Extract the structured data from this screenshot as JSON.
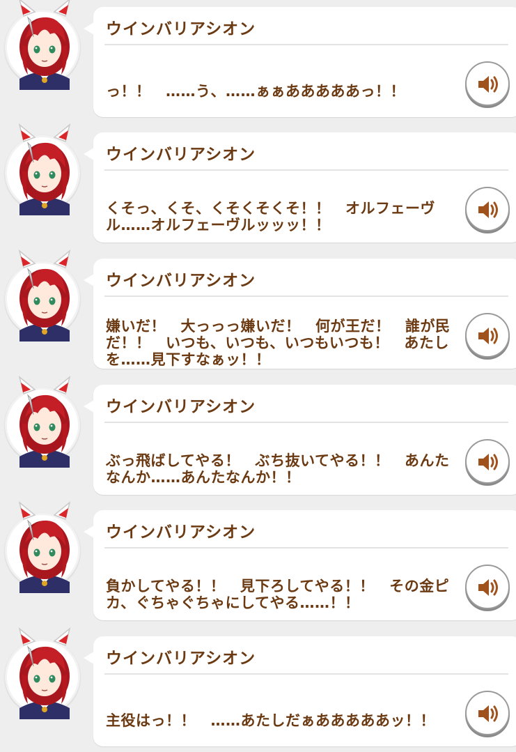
{
  "log": {
    "entries": [
      {
        "speaker": "ウインバリアシオン",
        "text": "っ！！　……う、……ぁぁあああああっ！！",
        "voice_icon": "speaker-icon"
      },
      {
        "speaker": "ウインバリアシオン",
        "text": "くそっ、くそ、くそくそくそ！！　オルフェーヴル……オルフェーヴルッッッ！！",
        "voice_icon": "speaker-icon"
      },
      {
        "speaker": "ウインバリアシオン",
        "text": "嫌いだ！　大っっっ嫌いだ！　何が王だ！　誰が民だ！！　いつも、いつも、いつもいつも！　あたしを……見下すなぁッ！！",
        "voice_icon": "speaker-icon"
      },
      {
        "speaker": "ウインバリアシオン",
        "text": "ぶっ飛ばしてやる！　ぶち抜いてやる！！　あんたなんか……あんたなんか！！",
        "voice_icon": "speaker-icon"
      },
      {
        "speaker": "ウインバリアシオン",
        "text": "負かしてやる！！　見下ろしてやる！！　その金ピカ、ぐちゃぐちゃにしてやる……！！",
        "voice_icon": "speaker-icon"
      },
      {
        "speaker": "ウインバリアシオン",
        "text": "主役はっ！！　……あたしだぁあああああッ！！",
        "voice_icon": "speaker-icon"
      }
    ]
  },
  "colors": {
    "background": "#eeeeee",
    "bubble": "#ffffff",
    "text": "#6b3a12",
    "icon": "#a0521d"
  }
}
